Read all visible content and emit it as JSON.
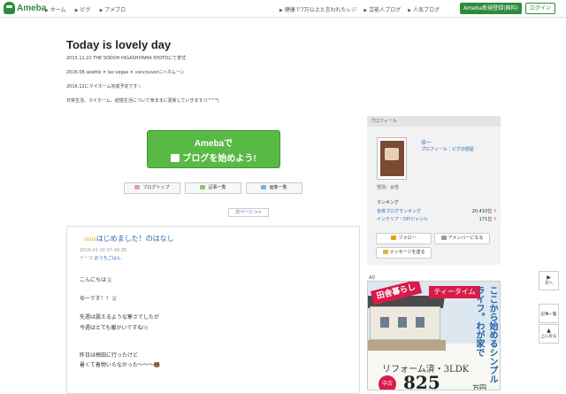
{
  "topbar": {
    "logo": "Ameba",
    "nav": [
      "ホーム",
      "ピグ",
      "アメブロ"
    ],
    "right_nav": [
      "芸能人ブログ",
      "人気ブログ"
    ],
    "right_nav_first": "健康で7万以上と言われたレジ",
    "register_button": "Ameba新規登録(無料)",
    "login_button": "ログイン"
  },
  "blog": {
    "title": "Today is lovely day",
    "desc_lines": [
      "2015.11.22 THE SODOH HIGASHIYAMA KYOTOにて挙式",
      "2016.08 seattle ✕ las vegas ✕ vancouverにハネムーン",
      "2016.12にマイホーム完成予定です☆",
      "日常生活、マイホーム、結婚生活について気ままに更新していきます♪(^^*)"
    ]
  },
  "cta": {
    "line1": "Amebaで",
    "line2": "ブログを始めよう!"
  },
  "buttons": {
    "blog_top": "ブログトップ",
    "article_list": "記事一覧",
    "image_list": "画像一覧"
  },
  "pager": {
    "next": "次ページ >>"
  },
  "article": {
    "tag": "oisix",
    "title": "はじめました！のはなし",
    "date": "2016-01-16 07:44:26",
    "theme_label": "テーマ:",
    "theme": "おうちごはん",
    "body": [
      "こんにちは🐰",
      "ゆーです！！🐰",
      "先週は震えるような寒さでしたが",
      "今週はとても暖かいですね🐚",
      "昨日は梅田に行ったけど",
      "暑くて着物いらなかった〜〜〜🐻"
    ]
  },
  "profile": {
    "header": "プロフィール",
    "name": "ゆー",
    "links": "プロフィール｜ピグの部屋",
    "gender": "性別：女性",
    "ranking_title": "ランキング",
    "rankings": [
      {
        "name": "全体ブログランキング",
        "value": "20,410位",
        "arrow": "↑"
      },
      {
        "name": "インテリア・DIYジャンル",
        "value": "171位",
        "arrow": "↑"
      }
    ],
    "follow_button": "フォロー",
    "member_button": "アメンバーになる",
    "message_button": "メッセージを送る"
  },
  "ad": {
    "label": "AD",
    "badge": "田舎暮らし",
    "tag": "ティータイム",
    "vertical": "ここから始めるシンプルライフ。わが家で",
    "reform": "リフォーム済・3LDK",
    "circle": "中古",
    "price": "825",
    "yen": "万円"
  },
  "floating_nav": {
    "next": "次へ",
    "list": "記事一覧",
    "top": "上に戻る"
  }
}
